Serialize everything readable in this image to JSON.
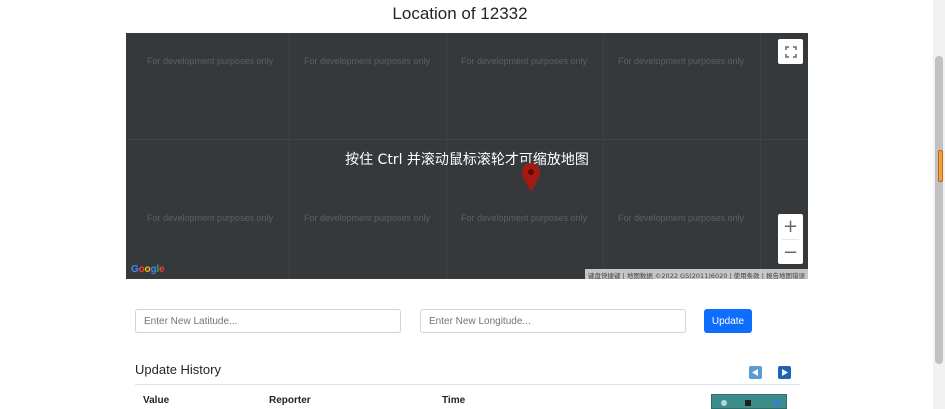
{
  "page": {
    "title": "Location of 12332"
  },
  "map": {
    "watermark_text": "For development purposes only",
    "overlay_message": "按住 Ctrl 并滚动鼠标滚轮才可缩放地图",
    "zoom_in_label": "+",
    "zoom_out_label": "−",
    "google_logo": "Google",
    "attribution": "键盘快捷键 | 地图数据 ©2022 GS(2011)6020 | 使用条款 | 报告地图错误",
    "background_color": "#36393c",
    "marker_color": "#a31a12"
  },
  "form": {
    "latitude_placeholder": "Enter New Latitude...",
    "longitude_placeholder": "Enter New Longitude...",
    "update_label": "Update",
    "button_color": "#0d6efd"
  },
  "history": {
    "title": "Update History",
    "columns": [
      "Value",
      "Reporter",
      "Time"
    ]
  }
}
